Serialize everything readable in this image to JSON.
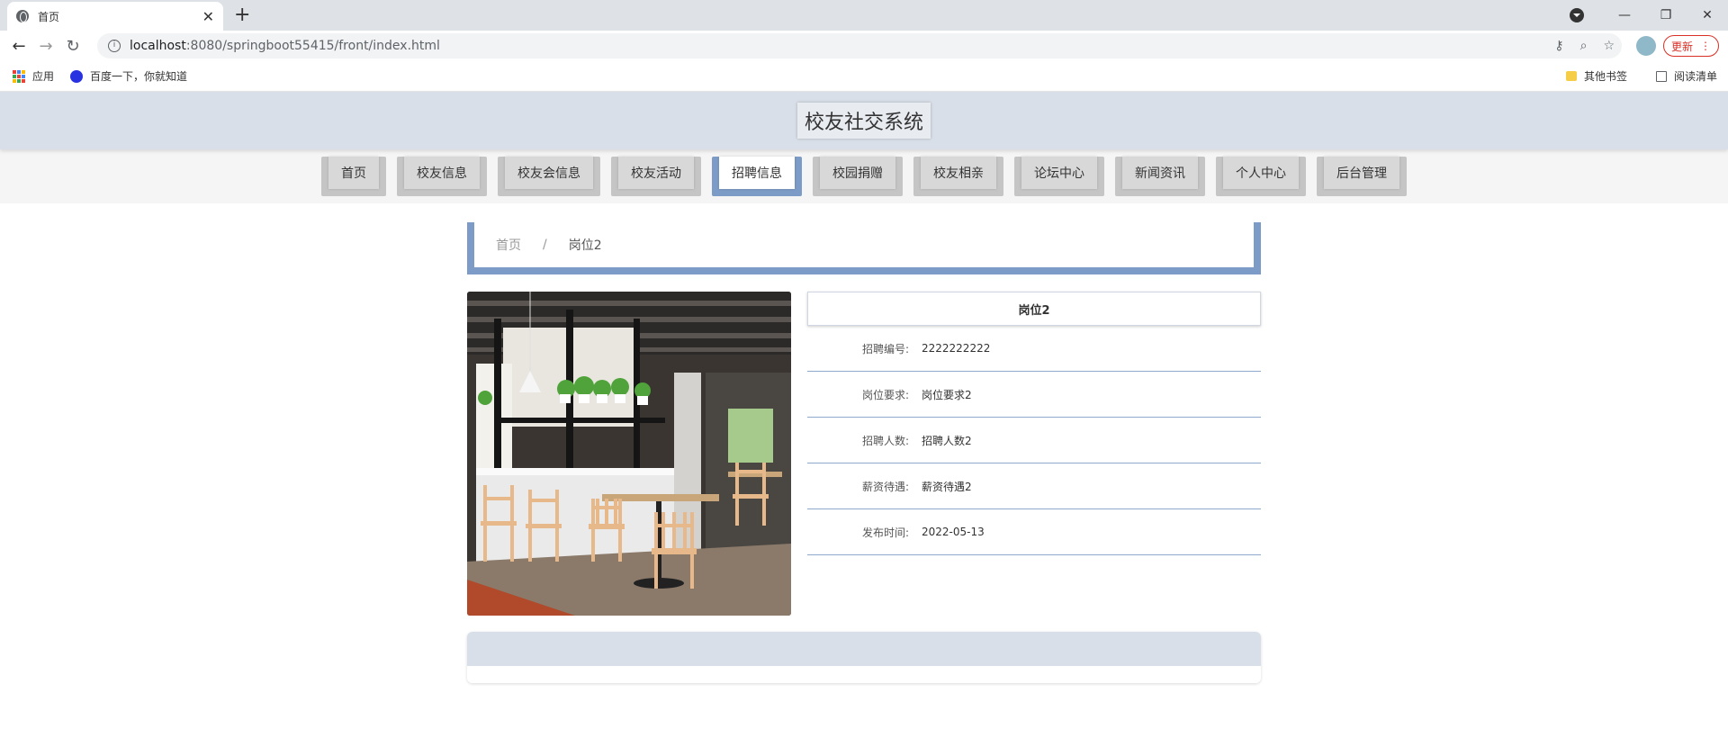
{
  "browser": {
    "tab_title": "首页",
    "tab_close": "✕",
    "new_tab": "+",
    "url_host": "localhost",
    "url_path": ":8080/springboot55415/front/index.html",
    "update_label": "更新",
    "bookmarks": {
      "apps": "应用",
      "baidu": "百度一下，你就知道",
      "other": "其他书签",
      "reading_list": "阅读清单"
    }
  },
  "site": {
    "title": "校友社交系统",
    "nav": [
      {
        "label": "首页",
        "active": false
      },
      {
        "label": "校友信息",
        "active": false
      },
      {
        "label": "校友会信息",
        "active": false
      },
      {
        "label": "校友活动",
        "active": false
      },
      {
        "label": "招聘信息",
        "active": true
      },
      {
        "label": "校园捐赠",
        "active": false
      },
      {
        "label": "校友相亲",
        "active": false
      },
      {
        "label": "论坛中心",
        "active": false
      },
      {
        "label": "新闻资讯",
        "active": false
      },
      {
        "label": "个人中心",
        "active": false
      },
      {
        "label": "后台管理",
        "active": false
      }
    ]
  },
  "breadcrumb": {
    "home": "首页",
    "separator": "/",
    "current": "岗位2"
  },
  "detail": {
    "title": "岗位2",
    "rows": [
      {
        "label": "招聘编号:",
        "value": "2222222222"
      },
      {
        "label": "岗位要求:",
        "value": "岗位要求2"
      },
      {
        "label": "招聘人数:",
        "value": "招聘人数2"
      },
      {
        "label": "薪资待遇:",
        "value": "薪资待遇2"
      },
      {
        "label": "发布时间:",
        "value": "2022-05-13"
      }
    ]
  },
  "colors": {
    "accent": "#7c9bc6",
    "header_bg": "#d9dfe8"
  }
}
